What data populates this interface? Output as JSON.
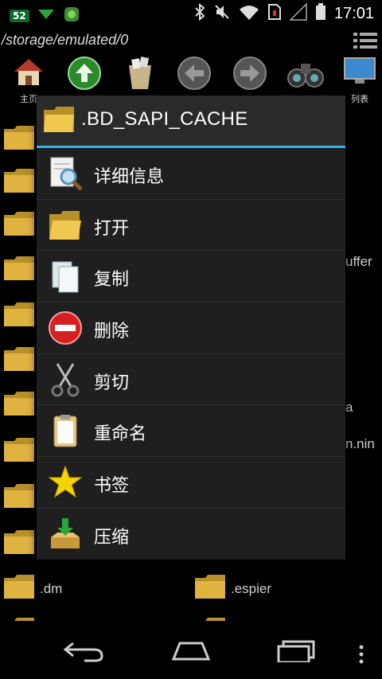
{
  "status_bar": {
    "notification_badge": "52",
    "time": "17:01"
  },
  "path": "/storage/emulated/0",
  "toolbar": {
    "home_label": "主页",
    "list_label": "列表"
  },
  "background_items": {
    "dm": ".dm",
    "espier": ".espier",
    "partial_1": "uffer",
    "partial_2": "a",
    "partial_3": "n.nin"
  },
  "dialog": {
    "title": ".BD_SAPI_CACHE",
    "items": [
      {
        "label": "详细信息",
        "icon": "details-icon"
      },
      {
        "label": "打开",
        "icon": "open-folder-icon"
      },
      {
        "label": "复制",
        "icon": "copy-icon"
      },
      {
        "label": "删除",
        "icon": "delete-icon"
      },
      {
        "label": "剪切",
        "icon": "scissors-icon"
      },
      {
        "label": "重命名",
        "icon": "rename-icon"
      },
      {
        "label": "书签",
        "icon": "star-icon"
      },
      {
        "label": "压缩",
        "icon": "compress-icon"
      }
    ]
  },
  "colors": {
    "accent": "#33b5e5",
    "dialog_bg": "#1f1f1f",
    "folder": "#e0b341"
  }
}
